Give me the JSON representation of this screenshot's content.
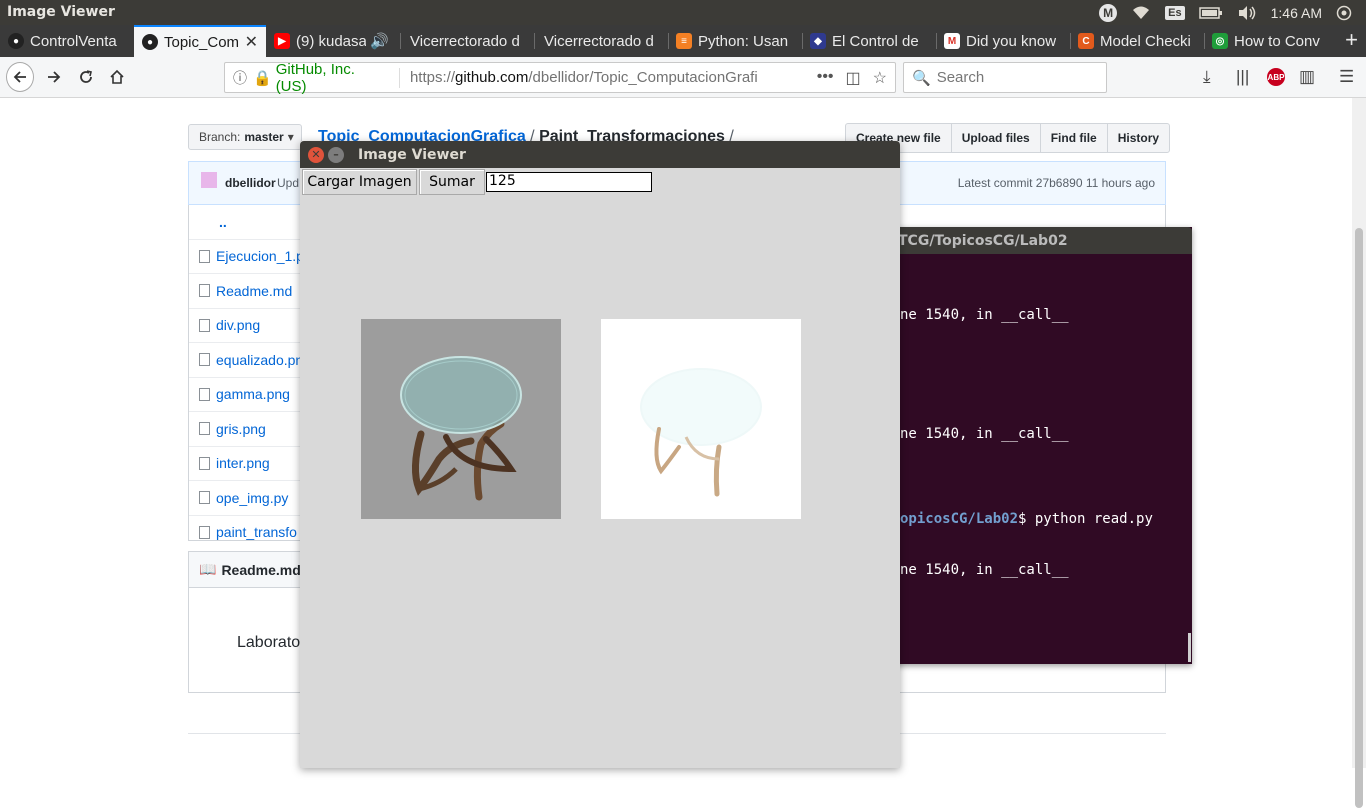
{
  "top_panel": {
    "app_title": "Image Viewer",
    "lang": "Es",
    "mail_letter": "M",
    "time": "1:46 AM"
  },
  "tabs": [
    {
      "label": "ControlVenta",
      "icon": "github-icon",
      "active": false
    },
    {
      "label": "Topic_Com",
      "icon": "github-icon",
      "active": true
    },
    {
      "label": "(9) kudasai",
      "icon": "youtube-icon",
      "active": false
    },
    {
      "label": "Vicerrectorado d",
      "icon": "page-icon",
      "active": false
    },
    {
      "label": "Vicerrectorado d",
      "icon": "page-icon",
      "active": false
    },
    {
      "label": "Python: Usan",
      "icon": "stackoverflow-icon",
      "active": false
    },
    {
      "label": "El Control de",
      "icon": "blue-icon",
      "active": false
    },
    {
      "label": "Did you know",
      "icon": "gmail-icon",
      "active": false
    },
    {
      "label": "Model Checki",
      "icon": "c-icon",
      "active": false
    },
    {
      "label": "How to Conv",
      "icon": "green-icon",
      "active": false
    }
  ],
  "navbar": {
    "site_identity": "GitHub, Inc. (US)",
    "url_prefix": "https://",
    "url_host": "github.com",
    "url_path": "/dbellidor/Topic_ComputacionGrafi",
    "search_placeholder": "Search"
  },
  "github": {
    "branch_label": "Branch:",
    "branch_name": "master",
    "breadcrumb_repo": "Topic_ComputacionGrafica",
    "breadcrumb_sep": " / ",
    "breadcrumb_dir": "Paint_Transformaciones",
    "breadcrumb_trail": " /",
    "buttons": [
      "Create new file",
      "Upload files",
      "Find file",
      "History"
    ],
    "commit_author": "dbellidor",
    "commit_message": "Upd",
    "latest_commit": "Latest commit 27b6890 11 hours ago",
    "files": [
      "..",
      "Ejecucion_1.p",
      "Readme.md",
      "div.png",
      "equalizado.pn",
      "gamma.png",
      "gris.png",
      "inter.png",
      "ope_img.py",
      "paint_transfo"
    ],
    "readme_title": "Readme.md",
    "readme_text": "Laborato"
  },
  "terminal": {
    "title": "TCG/TopicosCG/Lab02",
    "lines": [
      "ne 1540, in __call__",
      "ne 1540, in __call__",
      "opicosCG/Lab02$ python read.py",
      "ne 1540, in __call__"
    ],
    "prompt_path": "opicosCG/Lab02",
    "prompt_cmd": "$ python read.py"
  },
  "viewer": {
    "title": "Image Viewer",
    "load_button": "Cargar Imagen",
    "add_button": "Sumar",
    "entry_value": "125"
  },
  "colors": {
    "panel": "#3c3b37",
    "terminal_bg": "#300a24",
    "tk_bg": "#d9d9d9",
    "github_link": "#0366d6"
  }
}
